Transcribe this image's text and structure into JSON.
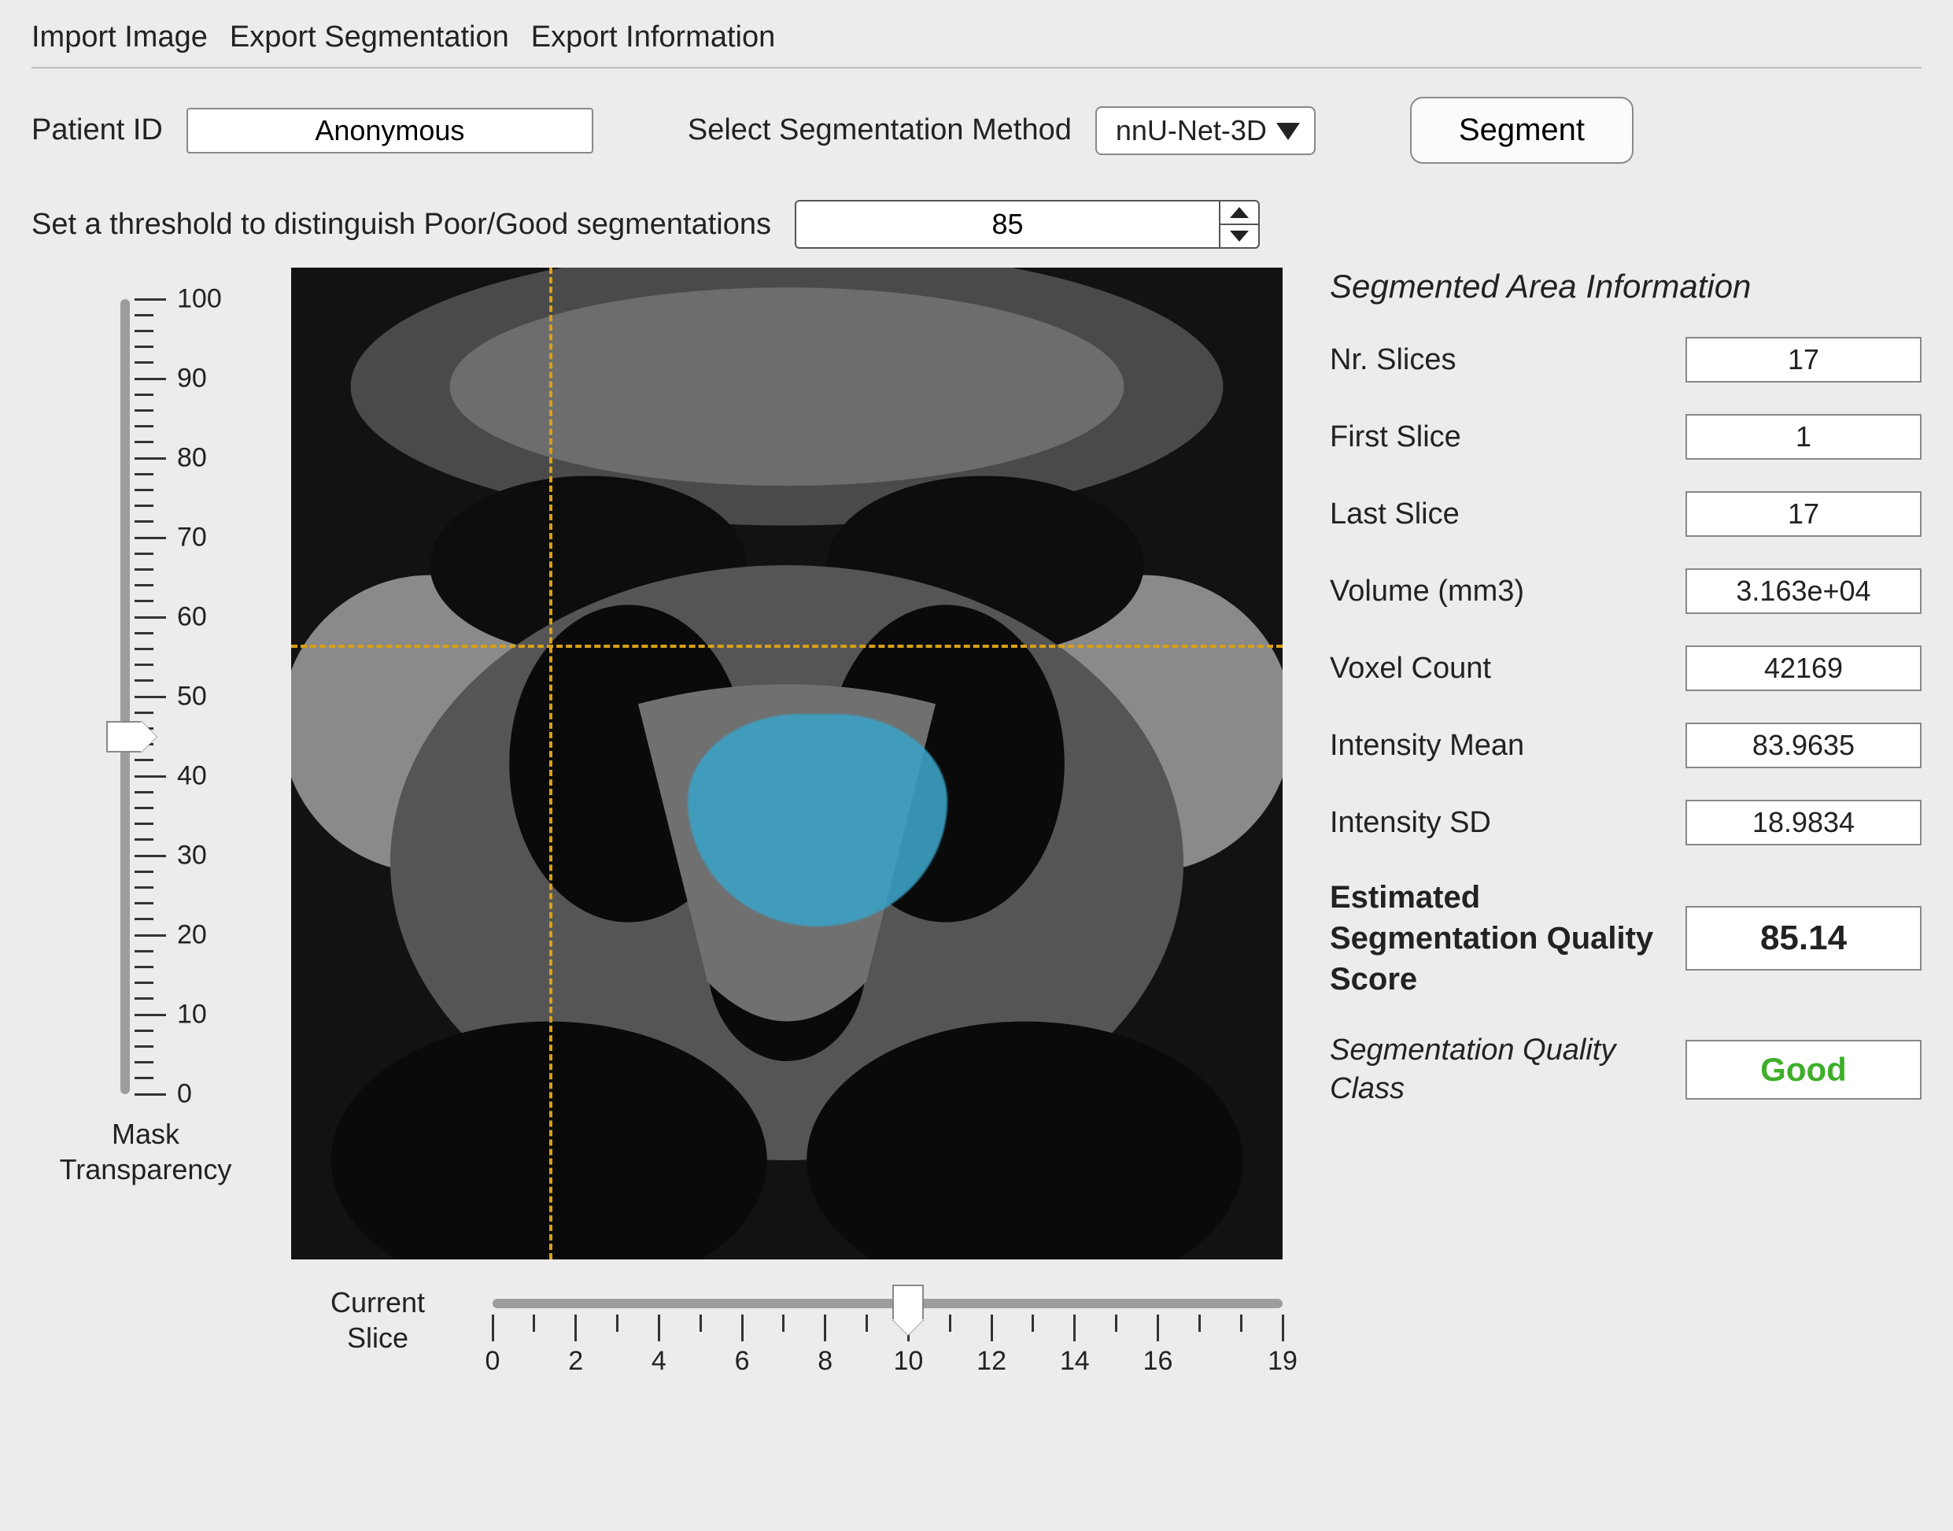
{
  "menu": {
    "import_image": "Import Image",
    "export_segmentation": "Export Segmentation",
    "export_information": "Export Information"
  },
  "top": {
    "patient_id_label": "Patient ID",
    "patient_id_value": "Anonymous",
    "seg_method_label": "Select Segmentation Method",
    "seg_method_value": "nnU-Net-3D",
    "segment_button": "Segment"
  },
  "threshold": {
    "label": "Set a threshold to distinguish Poor/Good segmentations",
    "value": "85"
  },
  "transparency": {
    "label": "Mask\nTransparency",
    "min": 0,
    "max": 100,
    "value": 45,
    "major_ticks": [
      0,
      10,
      20,
      30,
      40,
      50,
      60,
      70,
      80,
      90,
      100
    ]
  },
  "slice_slider": {
    "label": "Current\nSlice",
    "min": 0,
    "max": 19,
    "value": 10,
    "major_ticks": [
      0,
      2,
      4,
      6,
      8,
      10,
      12,
      14,
      16,
      19
    ]
  },
  "info": {
    "title": "Segmented Area Information",
    "rows": [
      {
        "label": "Nr. Slices",
        "value": "17"
      },
      {
        "label": "First Slice",
        "value": "1"
      },
      {
        "label": "Last Slice",
        "value": "17"
      },
      {
        "label": "Volume (mm3)",
        "value": "3.163e+04"
      },
      {
        "label": "Voxel Count",
        "value": "42169"
      },
      {
        "label": "Intensity Mean",
        "value": "83.9635"
      },
      {
        "label": "Intensity SD",
        "value": "18.9834"
      }
    ],
    "score_label": "Estimated Segmentation Quality Score",
    "score_value": "85.14",
    "class_label": "Segmentation Quality Class",
    "class_value": "Good"
  },
  "colors": {
    "mask": "#3ca1c4",
    "crosshair": "#d7a017",
    "good": "#3fae2a"
  }
}
